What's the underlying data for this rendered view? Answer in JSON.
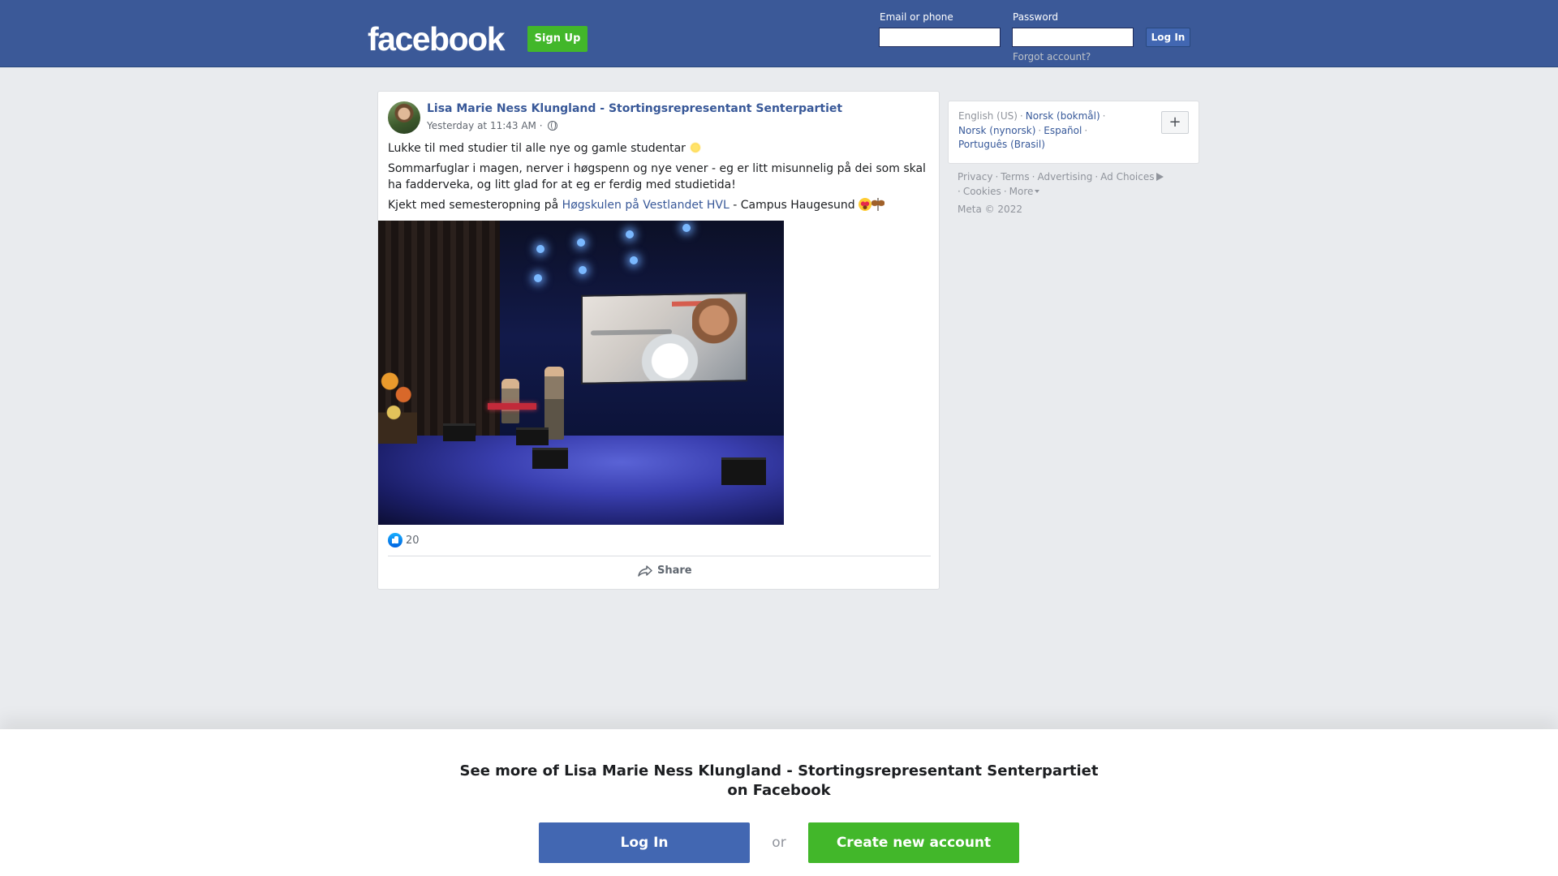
{
  "header": {
    "logo": "facebook",
    "signup_label": "Sign Up",
    "email_label": "Email or phone",
    "password_label": "Password",
    "email_value": "",
    "password_value": "",
    "login_label": "Log In",
    "forgot_label": "Forgot account?",
    "brand_color": "#3b5998"
  },
  "post": {
    "author": "Lisa Marie Ness Klungland - Stortingsrepresentant Senterpartiet",
    "timestamp": "Yesterday at 11:43 AM",
    "meta_separator": "·",
    "audience_icon": "globe-icon",
    "line1": "Lukke til med studier til alle nye og gamle studentar",
    "line2": "Sommarfuglar i magen, nerver i høgspenn og nye vener - eg er litt misunnelig på dei som skal ha fadderveka, og litt glad for at eg er ferdig med studietida!",
    "line3_prefix": "Kjekt med semesteropning på ",
    "line3_link": "Høgskulen på Vestlandet HVL",
    "line3_suffix": " - Campus Haugesund",
    "reaction_count": "20",
    "share_label": "Share"
  },
  "sidebar": {
    "lang_current": "English (US)",
    "lang_1": "Norsk (bokmål)",
    "lang_2": "Norsk (nynorsk)",
    "lang_3": "Español",
    "lang_4": "Português (Brasil)",
    "add_lang": "+",
    "footer": {
      "privacy": "Privacy",
      "terms": "Terms",
      "advertising": "Advertising",
      "ad_choices": "Ad Choices",
      "cookies": "Cookies",
      "more": "More",
      "copyright": "Meta © 2022"
    }
  },
  "bottom": {
    "title_line1": "See more of Lisa Marie Ness Klungland - Stortingsrepresentant Senterpartiet",
    "title_line2": "on Facebook",
    "login_label": "Log In",
    "or_label": "or",
    "create_label": "Create new account",
    "login_color": "#4267b2",
    "create_color": "#42b72a"
  }
}
